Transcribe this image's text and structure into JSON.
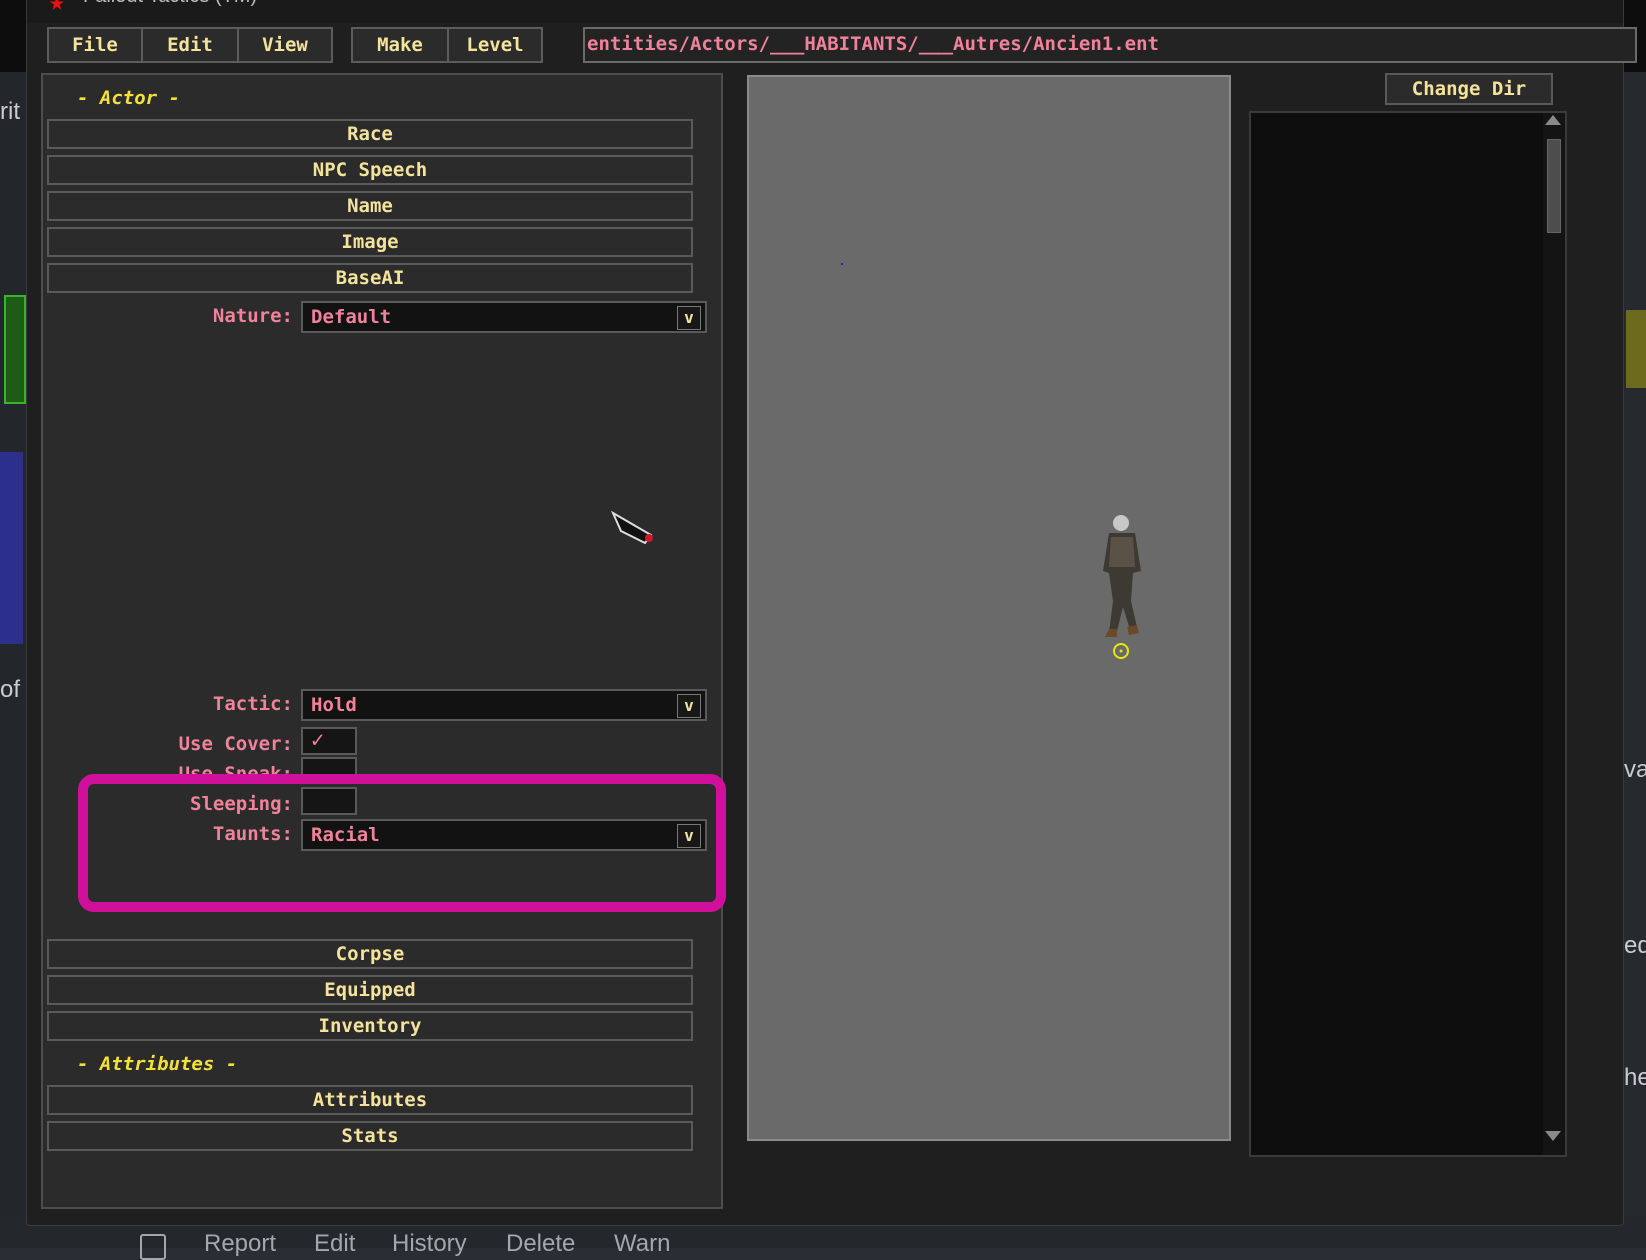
{
  "window": {
    "title": "Fallout Tactics (TM)"
  },
  "menubar": {
    "file": "File",
    "edit": "Edit",
    "view": "View",
    "make": "Make",
    "level": "Level",
    "path": "entities/Actors/___HABITANTS/___Autres/Ancien1.ent"
  },
  "actor": {
    "header": "- Actor -",
    "race": "Race",
    "npc_speech": "NPC Speech",
    "name": "Name",
    "image": "Image",
    "baseai": "BaseAI",
    "nature_label": "Nature:",
    "nature_value": "Default",
    "tactic_label": "Tactic:",
    "tactic_value": "Hold",
    "use_cover_label": "Use Cover:",
    "use_cover_checked": true,
    "use_sneak_label": "Use Sneak:",
    "use_sneak_checked": false,
    "sleeping_label": "Sleeping:",
    "sleeping_checked": false,
    "taunts_label": "Taunts:",
    "taunts_value": "Racial",
    "corpse": "Corpse",
    "equipped": "Equipped",
    "inventory": "Inventory"
  },
  "attributes": {
    "header": "- Attributes -",
    "attributes": "Attributes",
    "stats": "Stats"
  },
  "right_panel": {
    "change_dir": "Change Dir"
  },
  "background": {
    "left_frag_1": "rit",
    "left_frag_2": "of",
    "right_frag_1": "va",
    "right_frag_2": "ed",
    "right_frag_3": "he",
    "bottom_links": [
      "Report",
      "Edit",
      "History",
      "Delete",
      "Warn"
    ]
  },
  "colors": {
    "label": "#f0839a",
    "button_text": "#f3e39b",
    "section_head": "#f3e03a",
    "highlight": "#d0109b",
    "preview_bg": "#6a6a6a"
  },
  "glyphs": {
    "dropdown_arrow": "v",
    "check": "✓"
  }
}
